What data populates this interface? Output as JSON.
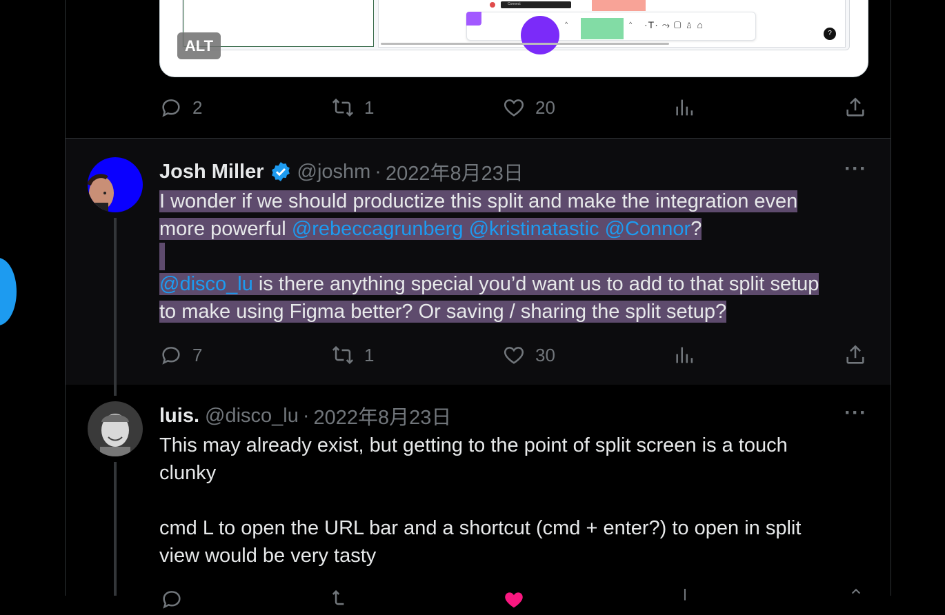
{
  "media": {
    "alt_badge": "ALT",
    "mini_label": "Connect"
  },
  "post1_actions": {
    "replies": "2",
    "reposts": "1",
    "likes": "20"
  },
  "post2": {
    "name": "Josh Miller",
    "handle": "@joshm",
    "separator": "·",
    "date": "2022年8月23日",
    "text_part1": "I wonder if we should productize this split and make the integration even",
    "text_part2a": "more powerful ",
    "mention1": "@rebeccagrunberg",
    "mention2": "@kristinatastic",
    "mention3": "@Connor",
    "text_part2b": "?",
    "mention4": "@disco_lu",
    "text_part3": " is there anything special you’d want us to add to that split setup",
    "text_part4": "to make using Figma better? Or saving / sharing the split setup?",
    "replies": "7",
    "reposts": "1",
    "likes": "30",
    "more": "···"
  },
  "post3": {
    "name": "luis.",
    "handle": "@disco_lu",
    "separator": "·",
    "date": "2022年8月23日",
    "text_line1": "This may already exist, but getting to the point of split screen is a touch",
    "text_line2": "clunky",
    "text_line3": "cmd L to open the URL bar and a shortcut (cmd + enter?) to open in split",
    "text_line4": "view would be very tasty",
    "more": "···"
  },
  "colors": {
    "accent": "#1d9bf0",
    "selection": "#5e4b6d",
    "muted": "#71767b"
  }
}
